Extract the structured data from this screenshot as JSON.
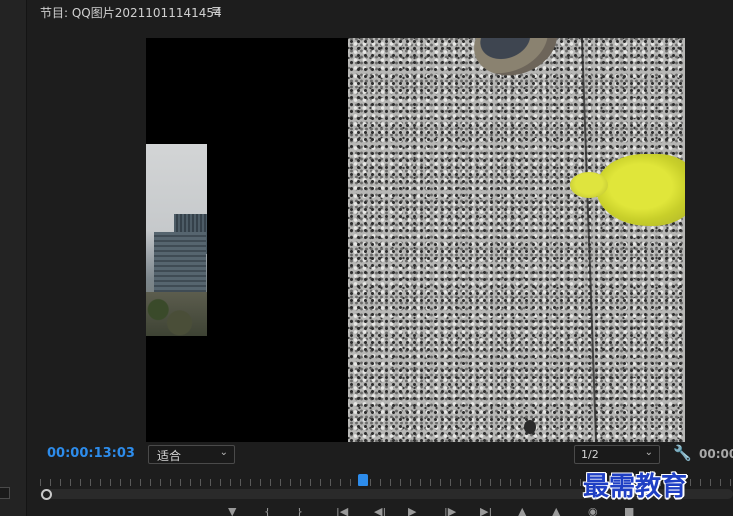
{
  "panel": {
    "title": "节目: QQ图片20211011141454",
    "menu_icon": "hamburger-menu-icon",
    "menu_glyph": "≡"
  },
  "monitor": {
    "current_timecode": "00:00:13:03",
    "duration_timecode": "00:00",
    "zoom": {
      "selected": "适合"
    },
    "resolution": {
      "selected": "1/2"
    },
    "settings_icon": "wrench-icon"
  },
  "transport": {
    "icons": [
      "add-marker-icon",
      "mark-in-icon",
      "mark-out-icon",
      "go-to-in-icon",
      "step-back-icon",
      "play-icon",
      "step-forward-icon",
      "go-to-out-icon",
      "lift-icon",
      "extract-icon",
      "export-frame-icon",
      "settings-icon"
    ]
  },
  "watermark": {
    "text": "最需教育"
  },
  "colors": {
    "accent": "#2d8ceb",
    "panel_bg": "#1d1d1d",
    "watermark": "#1f3fc4"
  }
}
